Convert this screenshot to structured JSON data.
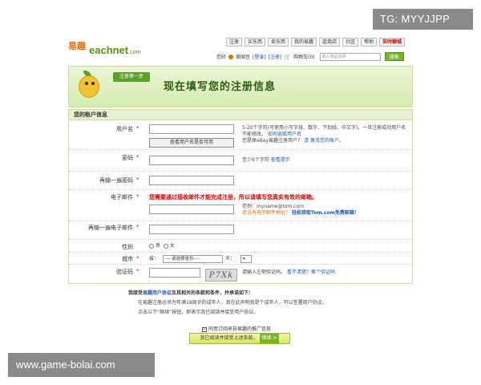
{
  "watermark_top": "TG: MYYJJPP",
  "watermark_bottom": "www.game-bolai.com",
  "logo": {
    "cn": "易趣",
    "en": "eachnet",
    "suffix": ".com"
  },
  "topnav": [
    "注册",
    "买东西",
    "卖东西",
    "我的易趣",
    "逛商店",
    "社区",
    "帮助",
    "实时聊城"
  ],
  "userbar": {
    "greet": "您好",
    "ebean": "美国豆",
    "login": "[登录]",
    "register": "[注册]",
    "cart": "购物车(0)",
    "search_placeholder": "输入物品名称",
    "search_btn": "搜索"
  },
  "banner": {
    "step": "注册第一步",
    "title": "现在填写您的注册信息"
  },
  "form": {
    "section_title": "您的账户信息",
    "username": {
      "label": "用户名",
      "hint1": "5-20个字符(可使用小写字母、数字、下划线、中文字)，一旦注册成功用户名不能修改。",
      "hint1_link": "如何选取用户名",
      "hint2": "您是原eBay易趣注册用户？",
      "hint2_link": "请 激活您的账户。",
      "check_btn": "查看用户名是否可用"
    },
    "password": {
      "label": "密码",
      "hint": "至少6个字符",
      "hint_link": "查看提示"
    },
    "password2": {
      "label": "再输一遍密码"
    },
    "email": {
      "label": "电子邮件",
      "warning": "您需要通过接收邮件才能完成注册，所以请填写您真实有效的邮箱。",
      "example": "范例：myname@tom.com",
      "no_email": "还没有电子邮件地址？",
      "tom_link": "轻松获取Tom.com免费邮箱！"
    },
    "email2": {
      "label": "再输一遍电子邮件"
    },
    "gender": {
      "label": "性别",
      "male": "男",
      "female": "女"
    },
    "city": {
      "label": "城市",
      "prov_label": "省：",
      "prov_value": "----请选择省份----",
      "city_label": "市："
    },
    "captcha": {
      "label": "验证码",
      "image_text": "P7Xk",
      "hint": "请输入左侧验证码。",
      "hint_link": "看不清楚？换个验证码"
    }
  },
  "agreement": {
    "title_pre": "我接受",
    "title_link": "易趣用户协议",
    "title_post": "及其相关的条款和条件，并承诺如下：",
    "line1": "在易趣注册必须为年满18周岁的成年人，我在此声明我是个成年人，可以签署用户协议。",
    "line2": "点击以下“继续”按钮，即表示我已阅读并接受用户协议。",
    "optin": "同意订阅来自易趣的推广信息",
    "submit": "我已阅读并接受上述条款，",
    "submit_go": "继续 >"
  }
}
